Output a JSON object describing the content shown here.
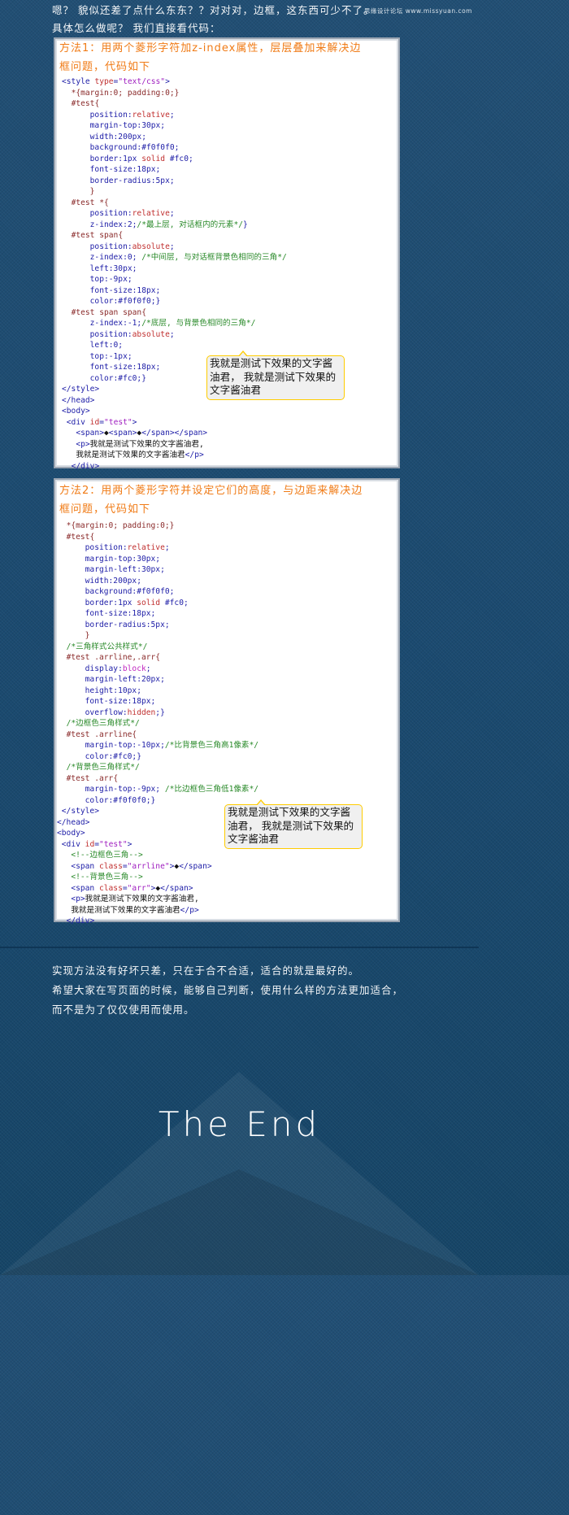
{
  "intro": {
    "line1": "嗯？  貌似还差了点什么东东？？对对对，边框，这东西可少不了。",
    "line2": "具体怎么做呢？  我们直接看代码："
  },
  "watermark": "思缘设计论坛 www.missyuan.com",
  "method1": {
    "title_line1": "方法1：用两个菱形字符加z-index属性，层层叠加来解决边",
    "title_line2": "框问题，代码如下",
    "tooltip": "我就是测试下效果的文字酱油君，  我就是测试下效果的文字酱油君"
  },
  "method2": {
    "title_line1": "方法2：用两个菱形字符并设定它们的高度，与边距来解决边",
    "title_line2": "框问题，代码如下",
    "tooltip": "我就是测试下效果的文字酱油君，  我就是测试下效果的文字酱油君"
  },
  "conclusion": {
    "line1": "实现方法没有好坏只差，只在于合不合适，适合的就是最好的。",
    "line2": "希望大家在写页面的时候，能够自己判断，使用什么样的方法更加适合，",
    "line3": "而不是为了仅仅使用而使用。"
  },
  "end_title": "The End",
  "code1": [
    [
      [
        "tg",
        "<style "
      ],
      [
        "at",
        "type"
      ],
      [
        "tg",
        "="
      ],
      [
        "vl",
        "\"text/css\""
      ],
      [
        "tg",
        ">"
      ]
    ],
    [
      [
        "tx",
        "  "
      ],
      [
        "pp",
        "*{margin:0; padding:0;}"
      ]
    ],
    [
      [
        "tx",
        "  "
      ],
      [
        "pp",
        "#test{"
      ]
    ],
    [
      [
        "tx",
        "      "
      ],
      [
        "tg",
        "position"
      ],
      [
        "tg",
        ":"
      ],
      [
        "at",
        "relative"
      ],
      [
        "tg",
        ";"
      ]
    ],
    [
      [
        "tx",
        "      "
      ],
      [
        "tg",
        "margin-top:30px;"
      ]
    ],
    [
      [
        "tx",
        "      "
      ],
      [
        "tg",
        "width:200px;"
      ]
    ],
    [
      [
        "tx",
        "      "
      ],
      [
        "tg",
        "background:#f0f0f0;"
      ]
    ],
    [
      [
        "tx",
        "      "
      ],
      [
        "tg",
        "border:1px "
      ],
      [
        "at",
        "solid"
      ],
      [
        "tg",
        " #fc0;"
      ]
    ],
    [
      [
        "tx",
        "      "
      ],
      [
        "tg",
        "font-size:18px;"
      ]
    ],
    [
      [
        "tx",
        "      "
      ],
      [
        "tg",
        "border-radius:5px;"
      ]
    ],
    [
      [
        "tx",
        "      "
      ],
      [
        "pp",
        "}"
      ]
    ],
    [
      [
        "tx",
        "  "
      ],
      [
        "pp",
        "#test *{"
      ]
    ],
    [
      [
        "tx",
        "      "
      ],
      [
        "tg",
        "position:"
      ],
      [
        "at",
        "relative"
      ],
      [
        "tg",
        ";"
      ]
    ],
    [
      [
        "tx",
        "      "
      ],
      [
        "tg",
        "z-index:2;"
      ],
      [
        "cm",
        "/*最上层, 对话框内的元素*/"
      ],
      [
        "tg",
        "}"
      ]
    ],
    [
      [
        "tx",
        "  "
      ],
      [
        "pp",
        "#test span{"
      ]
    ],
    [
      [
        "tx",
        "      "
      ],
      [
        "tg",
        "position:"
      ],
      [
        "at",
        "absolute"
      ],
      [
        "tg",
        ";"
      ]
    ],
    [
      [
        "tx",
        "      "
      ],
      [
        "tg",
        "z-index:0; "
      ],
      [
        "cm",
        "/*中间层, 与对话框背景色相同的三角*/"
      ]
    ],
    [
      [
        "tx",
        "      "
      ],
      [
        "tg",
        "left:30px;"
      ]
    ],
    [
      [
        "tx",
        "      "
      ],
      [
        "tg",
        "top:-9px;"
      ]
    ],
    [
      [
        "tx",
        "      "
      ],
      [
        "tg",
        "font-size:18px;"
      ]
    ],
    [
      [
        "tx",
        "      "
      ],
      [
        "tg",
        "color:#f0f0f0;}"
      ]
    ],
    [
      [
        "tx",
        "  "
      ],
      [
        "pp",
        "#test span span{"
      ]
    ],
    [
      [
        "tx",
        "      "
      ],
      [
        "tg",
        "z-index:-1;"
      ],
      [
        "cm",
        "/*底层, 与背景色相同的三角*/"
      ]
    ],
    [
      [
        "tx",
        "      "
      ],
      [
        "tg",
        "position:"
      ],
      [
        "at",
        "absolute"
      ],
      [
        "tg",
        ";"
      ]
    ],
    [
      [
        "tx",
        "      "
      ],
      [
        "tg",
        "left:0;"
      ]
    ],
    [
      [
        "tx",
        "      "
      ],
      [
        "tg",
        "top:-1px;"
      ]
    ],
    [
      [
        "tx",
        "      "
      ],
      [
        "tg",
        "font-size:18px;"
      ]
    ],
    [
      [
        "tx",
        "      "
      ],
      [
        "tg",
        "color:#fc0;}"
      ]
    ],
    [
      [
        "tg",
        "</style>"
      ]
    ],
    [
      [
        "tg",
        "</head>"
      ]
    ],
    [
      [
        "tg",
        "<body>"
      ]
    ],
    [
      [
        "tx",
        " "
      ],
      [
        "tg",
        "<div "
      ],
      [
        "at",
        "id"
      ],
      [
        "tg",
        "="
      ],
      [
        "vl",
        "\"test\""
      ],
      [
        "tg",
        ">"
      ]
    ],
    [
      [
        "tx",
        "   "
      ],
      [
        "tg",
        "<span>"
      ],
      [
        "tx",
        "◆"
      ],
      [
        "tg",
        "<span>"
      ],
      [
        "tx",
        "◆"
      ],
      [
        "tg",
        "</span></span>"
      ]
    ],
    [
      [
        "tx",
        "   "
      ],
      [
        "tg",
        "<p>"
      ],
      [
        "tx",
        "我就是测试下效果的文字酱油君,"
      ]
    ],
    [
      [
        "tx",
        "   我就是测试下效果的文字酱油君"
      ],
      [
        "tg",
        "</p>"
      ]
    ],
    [
      [
        "tx",
        "  "
      ],
      [
        "tg",
        "</div>"
      ]
    ]
  ],
  "code2": [
    [
      [
        "tx",
        "  "
      ],
      [
        "pp",
        "*{margin:0; padding:0;}"
      ]
    ],
    [
      [
        "tx",
        "  "
      ],
      [
        "pp",
        "#test{"
      ]
    ],
    [
      [
        "tx",
        "      "
      ],
      [
        "tg",
        "position:"
      ],
      [
        "at",
        "relative"
      ],
      [
        "tg",
        ";"
      ]
    ],
    [
      [
        "tx",
        "      "
      ],
      [
        "tg",
        "margin-top:30px;"
      ]
    ],
    [
      [
        "tx",
        "      "
      ],
      [
        "tg",
        "margin-left:30px;"
      ]
    ],
    [
      [
        "tx",
        "      "
      ],
      [
        "tg",
        "width:200px;"
      ]
    ],
    [
      [
        "tx",
        "      "
      ],
      [
        "tg",
        "background:#f0f0f0;"
      ]
    ],
    [
      [
        "tx",
        "      "
      ],
      [
        "tg",
        "border:1px "
      ],
      [
        "at",
        "solid"
      ],
      [
        "tg",
        " #fc0;"
      ]
    ],
    [
      [
        "tx",
        "      "
      ],
      [
        "tg",
        "font-size:18px;"
      ]
    ],
    [
      [
        "tx",
        "      "
      ],
      [
        "tg",
        "border-radius:5px;"
      ]
    ],
    [
      [
        "tx",
        "      "
      ],
      [
        "pp",
        "}"
      ]
    ],
    [
      [
        "tx",
        "  "
      ],
      [
        "cm",
        "/*三角样式公共样式*/"
      ]
    ],
    [
      [
        "tx",
        "  "
      ],
      [
        "pp",
        "#test .arrline,.arr{"
      ]
    ],
    [
      [
        "tx",
        "      "
      ],
      [
        "tg",
        "display:"
      ],
      [
        "kw",
        "block"
      ],
      [
        "tg",
        ";"
      ]
    ],
    [
      [
        "tx",
        "      "
      ],
      [
        "tg",
        "margin-left:20px;"
      ]
    ],
    [
      [
        "tx",
        "      "
      ],
      [
        "tg",
        "height:10px;"
      ]
    ],
    [
      [
        "tx",
        "      "
      ],
      [
        "tg",
        "font-size:18px;"
      ]
    ],
    [
      [
        "tx",
        "      "
      ],
      [
        "tg",
        "overflow:"
      ],
      [
        "at",
        "hidden"
      ],
      [
        "tg",
        ";}"
      ]
    ],
    [
      [
        "tx",
        "  "
      ],
      [
        "cm",
        "/*边框色三角样式*/"
      ]
    ],
    [
      [
        "tx",
        "  "
      ],
      [
        "pp",
        "#test .arrline{"
      ]
    ],
    [
      [
        "tx",
        "      "
      ],
      [
        "tg",
        "margin-top:-10px;"
      ],
      [
        "cm",
        "/*比背景色三角高1像素*/"
      ]
    ],
    [
      [
        "tx",
        "      "
      ],
      [
        "tg",
        "color:#fc0;}"
      ]
    ],
    [
      [
        "tx",
        "  "
      ],
      [
        "cm",
        "/*背景色三角样式*/"
      ]
    ],
    [
      [
        "tx",
        "  "
      ],
      [
        "pp",
        "#test .arr{"
      ]
    ],
    [
      [
        "tx",
        "      "
      ],
      [
        "tg",
        "margin-top:-9px; "
      ],
      [
        "cm",
        "/*比边框色三角低1像素*/"
      ]
    ],
    [
      [
        "tx",
        "      "
      ],
      [
        "tg",
        "color:#f0f0f0;}"
      ]
    ],
    [
      [
        "tx",
        " "
      ],
      [
        "tg",
        "</style>"
      ]
    ],
    [
      [
        "tg",
        "</head>"
      ]
    ],
    [
      [
        "tg",
        "<body>"
      ]
    ],
    [
      [
        "tx",
        " "
      ],
      [
        "tg",
        "<div "
      ],
      [
        "at",
        "id"
      ],
      [
        "tg",
        "="
      ],
      [
        "vl",
        "\"test\""
      ],
      [
        "tg",
        ">"
      ]
    ],
    [
      [
        "tx",
        "   "
      ],
      [
        "cm",
        "<!--边框色三角-->"
      ]
    ],
    [
      [
        "tx",
        "   "
      ],
      [
        "tg",
        "<span "
      ],
      [
        "at",
        "class"
      ],
      [
        "tg",
        "="
      ],
      [
        "vl",
        "\"arrline\""
      ],
      [
        "tg",
        ">"
      ],
      [
        "tx",
        "◆"
      ],
      [
        "tg",
        "</span>"
      ]
    ],
    [
      [
        "tx",
        "   "
      ],
      [
        "cm",
        "<!--背景色三角-->"
      ]
    ],
    [
      [
        "tx",
        "   "
      ],
      [
        "tg",
        "<span "
      ],
      [
        "at",
        "class"
      ],
      [
        "tg",
        "="
      ],
      [
        "vl",
        "\"arr\""
      ],
      [
        "tg",
        ">"
      ],
      [
        "tx",
        "◆"
      ],
      [
        "tg",
        "</span>"
      ]
    ],
    [
      [
        "tx",
        "   "
      ],
      [
        "tg",
        "<p>"
      ],
      [
        "tx",
        "我就是测试下效果的文字酱油君,"
      ]
    ],
    [
      [
        "tx",
        "   我就是测试下效果的文字酱油君"
      ],
      [
        "tg",
        "</p>"
      ]
    ],
    [
      [
        "tx",
        "  "
      ],
      [
        "tg",
        "</div>"
      ]
    ]
  ]
}
